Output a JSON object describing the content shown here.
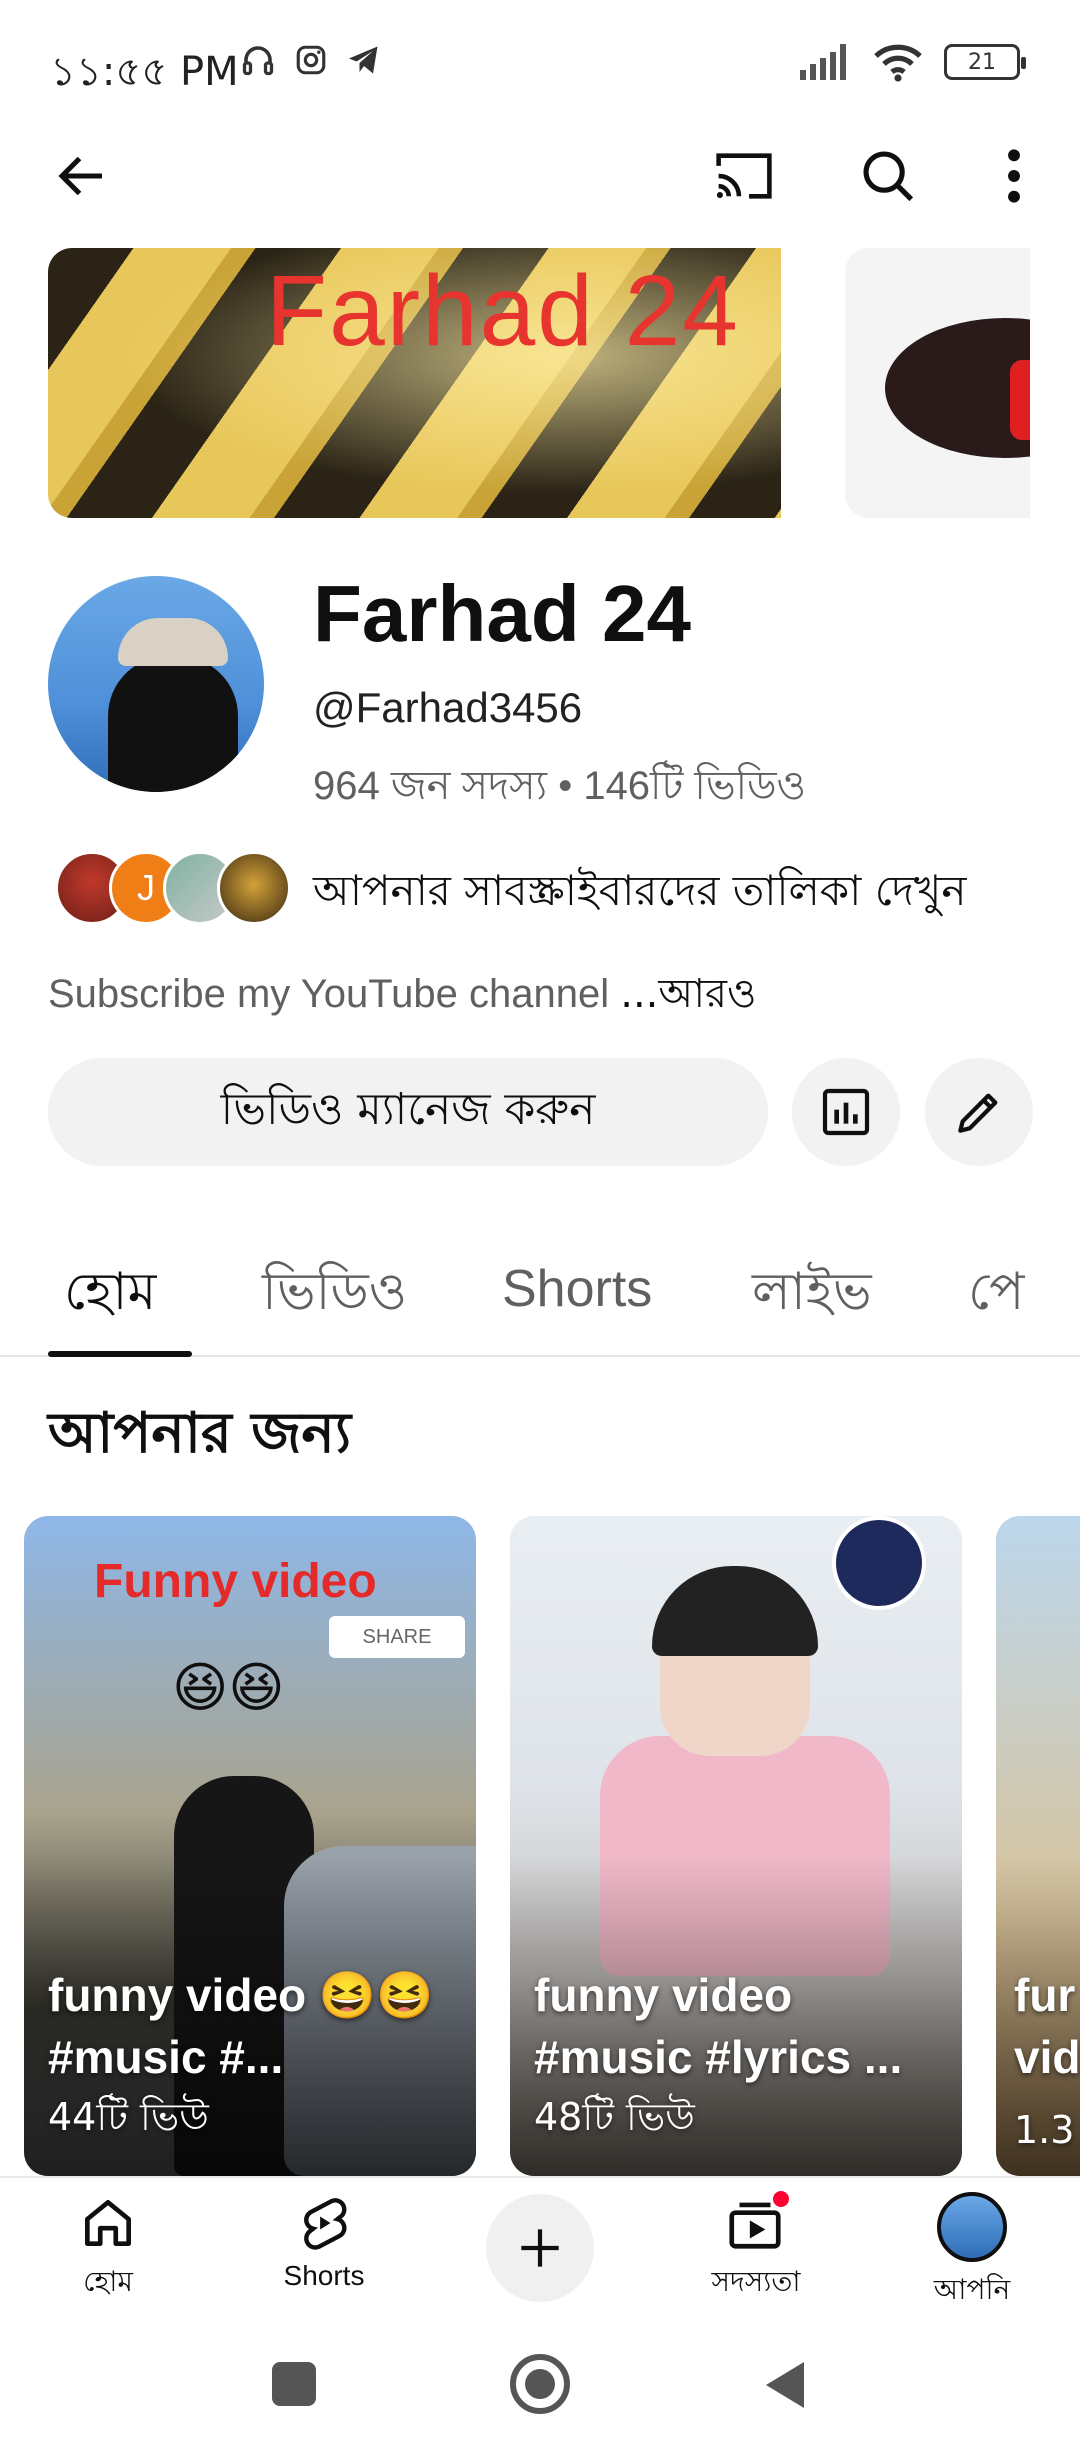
{
  "status_bar": {
    "time": "১১:৫৫ PM",
    "battery": "21"
  },
  "banner": {
    "title": "Farhad 24"
  },
  "channel": {
    "name": "Farhad 24",
    "handle": "@Farhad3456",
    "stats": "964 জন সদস্য • 146টি ভিডিও",
    "subscribers_link": "আপনার সাবস্ক্রাইবারদের তালিকা দেখুন",
    "subscriber_avatar_letter": "J",
    "description": "Subscribe my YouTube channel ",
    "description_more": "...আরও",
    "manage_button": "ভিডিও ম্যানেজ করুন"
  },
  "tabs": [
    {
      "label": "হোম",
      "active": true
    },
    {
      "label": "ভিডিও",
      "active": false
    },
    {
      "label": "Shorts",
      "active": false
    },
    {
      "label": "লাইভ",
      "active": false
    },
    {
      "label": "পে",
      "active": false
    }
  ],
  "section": {
    "title": "আপনার জন্য"
  },
  "shorts": [
    {
      "title": "funny video 😆😆 #music #...",
      "views": "44টি ভিউ",
      "overlay": "Funny video",
      "share": "SHARE"
    },
    {
      "title": "funny video #music #lyrics ...",
      "views": "48টি ভিউ"
    },
    {
      "title": "fur vid",
      "views": "1.3"
    }
  ],
  "bottom_nav": [
    {
      "label": "হোম",
      "icon": "home-icon"
    },
    {
      "label": "Shorts",
      "icon": "shorts-icon"
    },
    {
      "label": "",
      "icon": "create-icon"
    },
    {
      "label": "সদস্যতা",
      "icon": "subscriptions-icon"
    },
    {
      "label": "আপনি",
      "icon": "you-avatar"
    }
  ],
  "colors": {
    "accent_red": "#ff0000",
    "text_primary": "#0f0f0f",
    "text_secondary": "#606060"
  }
}
